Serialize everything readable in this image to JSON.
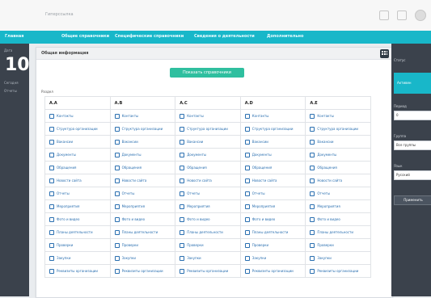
{
  "app": {
    "title": "Гиперссылка"
  },
  "nav": [
    "Главная",
    "Общие справочники",
    "Специфические справочники",
    "Сведения о деятельности",
    "Дополнительно"
  ],
  "leftbar": {
    "line1": "Дата",
    "big_number": "10",
    "line2": "Сегодня",
    "line3": "Отчеты"
  },
  "page": {
    "tab_label": "Общая информация",
    "button_label": "Показать справочники",
    "section_label": "Раздел"
  },
  "table": {
    "headers": [
      "A.A",
      "A.B",
      "A.C",
      "A.D",
      "A.E"
    ],
    "rows": [
      [
        "Контакты",
        "Контакты",
        "Контакты",
        "Контакты",
        "Контакты"
      ],
      [
        "Структура организации",
        "Структура организации",
        "Структура организации",
        "Структура организации",
        "Структура организации"
      ],
      [
        "Вакансии",
        "Вакансии",
        "Вакансии",
        "Вакансии",
        "Вакансии"
      ],
      [
        "Документы",
        "Документы",
        "Документы",
        "Документы",
        "Документы"
      ],
      [
        "Обращения",
        "Обращения",
        "Обращения",
        "Обращения",
        "Обращения"
      ],
      [
        "Новости сайта",
        "Новости сайта",
        "Новости сайта",
        "Новости сайта",
        "Новости сайта"
      ],
      [
        "Отчеты",
        "Отчеты",
        "Отчеты",
        "Отчеты",
        "Отчеты"
      ],
      [
        "Мероприятия",
        "Мероприятия",
        "Мероприятия",
        "Мероприятия",
        "Мероприятия"
      ],
      [
        "Фото и видео",
        "Фото и видео",
        "Фото и видео",
        "Фото и видео",
        "Фото и видео"
      ],
      [
        "Планы деятельности",
        "Планы деятельности",
        "Планы деятельности",
        "Планы деятельности",
        "Планы деятельности"
      ],
      [
        "Проверки",
        "Проверки",
        "Проверки",
        "Проверки",
        "Проверки"
      ],
      [
        "Закупки",
        "Закупки",
        "Закупки",
        "Закупки",
        "Закупки"
      ],
      [
        "Реквизиты организации",
        "Реквизиты организации",
        "Реквизиты организации",
        "Реквизиты организации",
        "Реквизиты организации"
      ]
    ]
  },
  "rightpanel": {
    "top_label": "Статус",
    "badge": "Активен",
    "label1": "Период",
    "box1": "0",
    "label2": "Группа",
    "box2": "Все группы",
    "label3": "Язык",
    "box3": "Русский",
    "action_label": "Применить"
  }
}
